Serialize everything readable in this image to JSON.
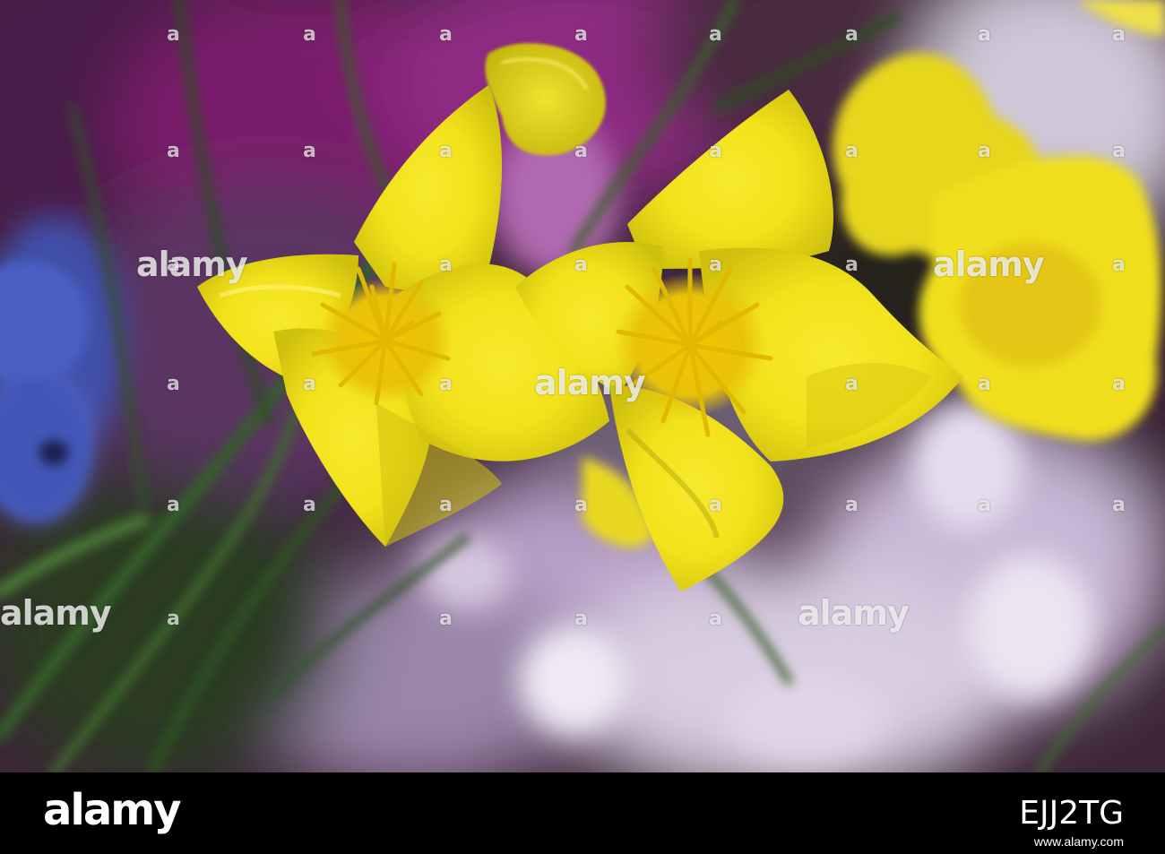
{
  "colors": {
    "petal_yellow": "#f2e21a",
    "petal_shadow": "#b9ac0b",
    "stamen_yellow": "#e0b800",
    "background_magenta": "#8a1f7a",
    "background_purple": "#6b3b8f",
    "background_lilac": "#c8b4d2",
    "stem_green": "#3f6b2e",
    "blue_flower": "#4b5fc4",
    "footer_black": "#000000"
  },
  "icons": {
    "watermark_mark": "alamy-watermark-text"
  },
  "watermark": {
    "text": "alamy",
    "small_marks": [
      "a",
      "a",
      "a",
      "a",
      "a",
      "a",
      "a",
      "a",
      "a",
      "a",
      "a",
      "a",
      "a",
      "a",
      "a",
      "a",
      "a",
      "a",
      "a",
      "a",
      "a",
      "a",
      "a",
      "a",
      "a",
      "a",
      "a",
      "a",
      "a",
      "a",
      "a",
      "a",
      "a",
      "a",
      "a",
      "a",
      "a",
      "a",
      "a",
      "a"
    ]
  },
  "footer": {
    "logo": "alamy",
    "image_id": "EJJ2TG",
    "url": "www.alamy.com"
  }
}
